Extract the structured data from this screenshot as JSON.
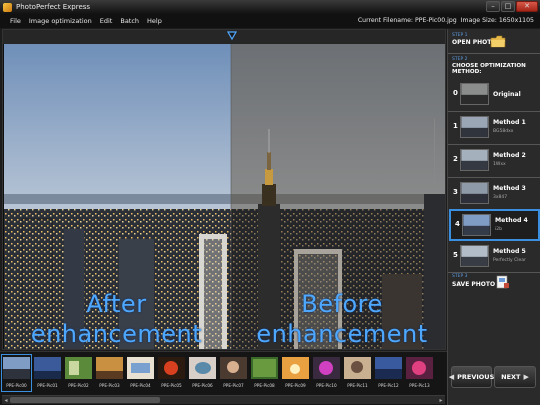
{
  "window": {
    "title": "PhotoPerfect Express",
    "controls": {
      "minimize": "–",
      "maximize": "□",
      "close": "✕"
    }
  },
  "menu": [
    "File",
    "Image optimization",
    "Edit",
    "Batch",
    "Help"
  ],
  "fileinfo": {
    "current_filename": "Current Filename: PPE-Pic00.jpg",
    "image_size": "Image Size: 1650x1105"
  },
  "photo": {
    "left_caption": "After enhancement",
    "right_caption": "Before enhancement"
  },
  "panel": {
    "step1": {
      "label": "STEP 1",
      "title": "OPEN PHOTO",
      "icon": "folder-icon"
    },
    "step2": {
      "label": "STEP 2",
      "title": "CHOOSE OPTIMIZATION METHOD:"
    },
    "methods": [
      {
        "num": "0",
        "name": "Original",
        "sub": ""
      },
      {
        "num": "1",
        "name": "Method 1",
        "sub": "BG58dxx"
      },
      {
        "num": "2",
        "name": "Method 2",
        "sub": "1Wxx"
      },
      {
        "num": "3",
        "name": "Method 3",
        "sub": "3x847"
      },
      {
        "num": "4",
        "name": "Method 4",
        "sub": "i2b"
      },
      {
        "num": "5",
        "name": "Method 5",
        "sub": "Perfectly Clear"
      }
    ],
    "selected_method": "4",
    "step3": {
      "label": "STEP 3",
      "title": "SAVE PHOTO AS",
      "icon": "save-icon"
    }
  },
  "thumbnails": [
    "PPE-Pic00",
    "PPE-Pic01",
    "PPE-Pic02",
    "PPE-Pic03",
    "PPE-Pic04",
    "PPE-Pic05",
    "PPE-Pic06",
    "PPE-Pic07",
    "PPE-Pic08",
    "PPE-Pic09",
    "PPE-Pic10",
    "PPE-Pic11",
    "PPE-Pic12",
    "PPE-Pic13",
    "PPE-Pic14"
  ],
  "active_thumbnail": "PPE-Pic00",
  "nav": {
    "prev": "PREVIOUS",
    "next": "NEXT"
  },
  "colors": {
    "accent": "#3b8fe0",
    "caption": "#4fa8ff",
    "panel_bg": "#2a2a2a"
  }
}
